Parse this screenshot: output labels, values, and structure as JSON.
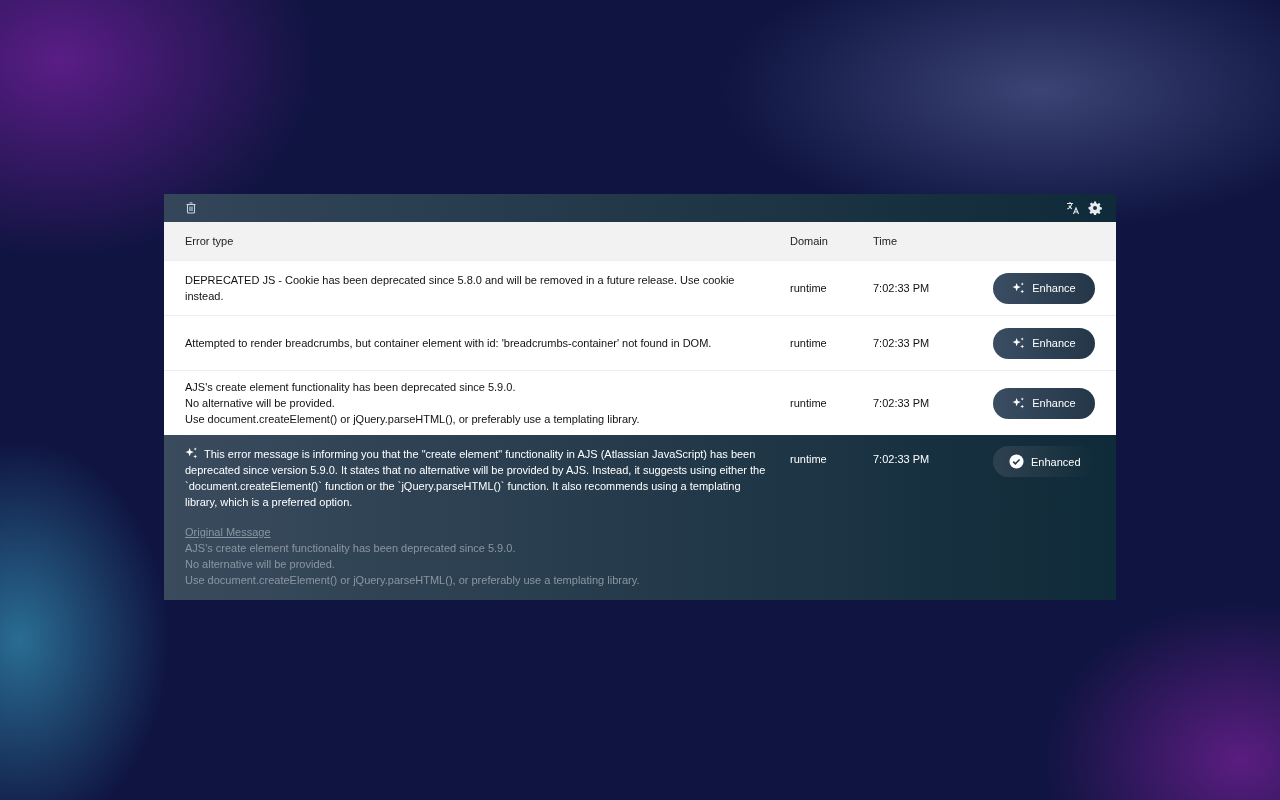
{
  "columns": {
    "error_type": "Error type",
    "domain": "Domain",
    "time": "Time"
  },
  "rows": [
    {
      "enhanced": false,
      "lines": [
        "DEPRECATED JS - Cookie has been deprecated since 5.8.0 and will be removed in a future release. Use cookie instead."
      ],
      "domain": "runtime",
      "time": "7:02:33 PM",
      "button": "Enhance"
    },
    {
      "enhanced": false,
      "lines": [
        "Attempted to render breadcrumbs, but container element with id: 'breadcrumbs-container' not found in DOM."
      ],
      "domain": "runtime",
      "time": "7:02:33 PM",
      "button": "Enhance"
    },
    {
      "enhanced": false,
      "lines": [
        "AJS's create element functionality has been deprecated since 5.9.0.",
        "No alternative will be provided.",
        "Use document.createElement() or jQuery.parseHTML(), or preferably use a templating library."
      ],
      "domain": "runtime",
      "time": "7:02:33 PM",
      "button": "Enhance"
    },
    {
      "enhanced": true,
      "explanation": "This error message is informing you that the \"create element\" functionality in AJS (Atlassian JavaScript) has been deprecated since version 5.9.0. It states that no alternative will be provided by AJS. Instead, it suggests using either the `document.createElement()` function or the `jQuery.parseHTML()` function. It also recommends using a templating library, which is a preferred option.",
      "original_label": "Original Message",
      "lines": [
        "AJS's create element functionality has been deprecated since 5.9.0.",
        "No alternative will be provided.",
        "Use document.createElement() or jQuery.parseHTML(), or preferably use a templating library."
      ],
      "domain": "runtime",
      "time": "7:02:33 PM",
      "button": "Enhanced"
    }
  ]
}
